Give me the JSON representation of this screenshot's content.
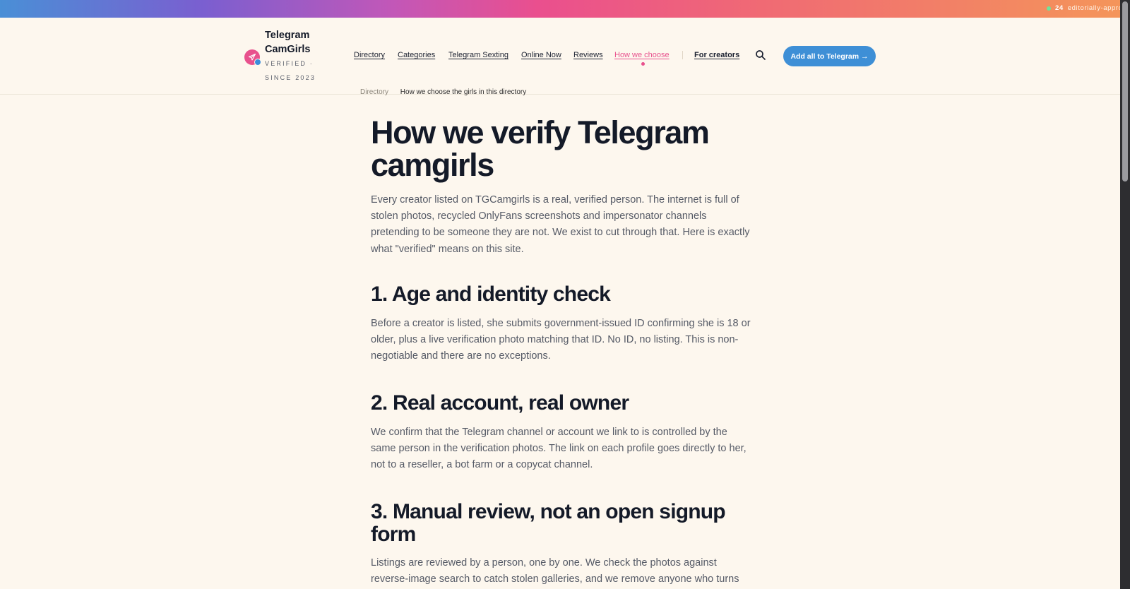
{
  "topbar": {
    "count": "24",
    "text": "editorially-appro"
  },
  "brand": {
    "name": "Telegram CamGirls",
    "tagline": "VERIFIED · SINCE 2023"
  },
  "nav": {
    "items": [
      {
        "label": "Directory"
      },
      {
        "label": "Categories"
      },
      {
        "label": "Telegram Sexting"
      },
      {
        "label": "Online Now"
      },
      {
        "label": "Reviews"
      },
      {
        "label": "How we choose",
        "active": true
      }
    ],
    "creators": "For creators",
    "cta": "Add all to Telegram →"
  },
  "breadcrumb": {
    "root": "Directory",
    "current": "How we choose the girls in this directory"
  },
  "article": {
    "title": "How we verify Telegram camgirls",
    "intro": "Every creator listed on TGCamgirls is a real, verified person. The internet is full of stolen photos, recycled OnlyFans screenshots and impersonator channels pretending to be someone they are not. We exist to cut through that. Here is exactly what \"verified\" means on this site.",
    "sections": [
      {
        "heading": "1. Age and identity check",
        "body": "Before a creator is listed, she submits government-issued ID confirming she is 18 or older, plus a live verification photo matching that ID. No ID, no listing. This is non-negotiable and there are no exceptions."
      },
      {
        "heading": "2. Real account, real owner",
        "body": "We confirm that the Telegram channel or account we link to is controlled by the same person in the verification photos. The link on each profile goes directly to her, not to a reseller, a bot farm or a copycat channel."
      },
      {
        "heading": "3. Manual review, not an open signup form",
        "body": "Listings are reviewed by a person, one by one. We check the photos against reverse-image search to catch stolen galleries, and we remove anyone who turns"
      }
    ]
  },
  "colors": {
    "accent_pink": "#e8518d",
    "accent_blue": "#3e8fd6",
    "background": "#fdf7ee"
  }
}
